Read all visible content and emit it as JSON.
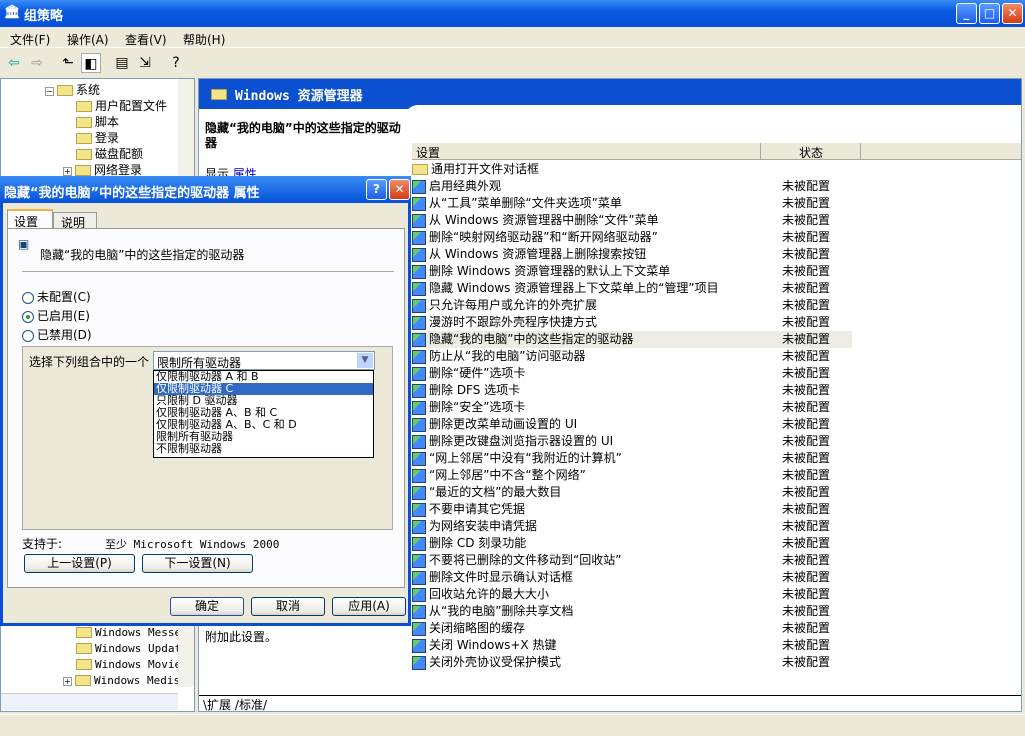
{
  "window": {
    "title": "组策略",
    "minimize": "_",
    "maximize": "□",
    "close": "✕"
  },
  "menu": [
    "文件(F)",
    "操作(A)",
    "查看(V)",
    "帮助(H)"
  ],
  "toolbar": [
    "back-icon",
    "forward-icon",
    "up-folder-icon",
    "show-hide-tree-icon",
    "properties-icon",
    "export-list-icon",
    "help-icon"
  ],
  "tree": {
    "items": [
      {
        "label": "系统",
        "indent": 0,
        "expander": "−"
      },
      {
        "label": "用户配置文件",
        "indent": 1
      },
      {
        "label": "脚本",
        "indent": 1
      },
      {
        "label": "登录",
        "indent": 1
      },
      {
        "label": "磁盘配额",
        "indent": 1
      },
      {
        "label": "网络登录",
        "indent": 1,
        "expander": "+"
      }
    ],
    "bottom_items": [
      {
        "label": "Windows Messe"
      },
      {
        "label": "Windows Updat"
      },
      {
        "label": "Windows Movie"
      },
      {
        "label": "Windows Medis",
        "expander": "+"
      }
    ]
  },
  "right": {
    "header": "Windows 资源管理器",
    "description_title": "隐藏“我的电脑”中的这些指定的驱动器",
    "description_link_prefix": "显示",
    "description_link": "属性",
    "description_tail": "附加此设置。",
    "columns": {
      "setting": "设置",
      "state": "状态"
    },
    "folder_row": "通用打开文件对话框",
    "rows": [
      {
        "name": "启用经典外观",
        "state": "未被配置"
      },
      {
        "name": "从“工具”菜单删除“文件夹选项”菜单",
        "state": "未被配置"
      },
      {
        "name": "从 Windows 资源管理器中删除“文件”菜单",
        "state": "未被配置"
      },
      {
        "name": "删除“映射网络驱动器”和“断开网络驱动器”",
        "state": "未被配置"
      },
      {
        "name": "从 Windows 资源管理器上删除搜索按钮",
        "state": "未被配置"
      },
      {
        "name": "删除 Windows 资源管理器的默认上下文菜单",
        "state": "未被配置"
      },
      {
        "name": "隐藏 Windows 资源管理器上下文菜单上的“管理”项目",
        "state": "未被配置"
      },
      {
        "name": "只允许每用户或允许的外壳扩展",
        "state": "未被配置"
      },
      {
        "name": "漫游时不跟踪外壳程序快捷方式",
        "state": "未被配置"
      },
      {
        "name": "隐藏“我的电脑”中的这些指定的驱动器",
        "state": "未被配置",
        "selected": true
      },
      {
        "name": "防止从“我的电脑”访问驱动器",
        "state": "未被配置"
      },
      {
        "name": "删除“硬件”选项卡",
        "state": "未被配置"
      },
      {
        "name": "删除 DFS 选项卡",
        "state": "未被配置"
      },
      {
        "name": "删除“安全”选项卡",
        "state": "未被配置"
      },
      {
        "name": "删除更改菜单动画设置的 UI",
        "state": "未被配置"
      },
      {
        "name": "删除更改键盘浏览指示器设置的 UI",
        "state": "未被配置"
      },
      {
        "name": "“网上邻居”中没有“我附近的计算机”",
        "state": "未被配置"
      },
      {
        "name": "“网上邻居”中不含“整个网络”",
        "state": "未被配置"
      },
      {
        "name": "“最近的文档”的最大数目",
        "state": "未被配置"
      },
      {
        "name": "不要申请其它凭据",
        "state": "未被配置"
      },
      {
        "name": "为网络安装申请凭据",
        "state": "未被配置"
      },
      {
        "name": "删除 CD 刻录功能",
        "state": "未被配置"
      },
      {
        "name": "不要将已删除的文件移动到“回收站”",
        "state": "未被配置"
      },
      {
        "name": "删除文件时显示确认对话框",
        "state": "未被配置"
      },
      {
        "name": "回收站允许的最大大小",
        "state": "未被配置"
      },
      {
        "name": "从“我的电脑”删除共享文档",
        "state": "未被配置"
      },
      {
        "name": "关闭缩略图的缓存",
        "state": "未被配置"
      },
      {
        "name": "关闭 Windows+X 热键",
        "state": "未被配置"
      },
      {
        "name": "关闭外壳协议受保护模式",
        "state": "未被配置"
      }
    ],
    "tabs": [
      "扩展",
      "标准"
    ]
  },
  "dialog": {
    "title": "隐藏“我的电脑”中的这些指定的驱动器 属性",
    "help": "?",
    "close": "✕",
    "tabs": [
      "设置",
      "说明"
    ],
    "policy_name": "隐藏“我的电脑”中的这些指定的驱动器",
    "options": [
      {
        "label": "未配置(C)",
        "checked": false
      },
      {
        "label": "已启用(E)",
        "checked": true
      },
      {
        "label": "已禁用(D)",
        "checked": false
      }
    ],
    "combo_label": "选择下列组合中的一个",
    "combo_value": "限制所有驱动器",
    "combo_options": [
      "仅限制驱动器 A 和 B",
      "仅限制驱动器 C",
      "只限制 D 驱动器",
      "仅限制驱动器 A、B 和 C",
      "仅限制驱动器 A、B、C 和 D",
      "限制所有驱动器",
      "不限制驱动器"
    ],
    "combo_highlighted": 1,
    "supported_label": "支持于:",
    "supported_value": "至少 Microsoft Windows 2000",
    "prev": "上一设置(P)",
    "next": "下一设置(N)",
    "ok": "确定",
    "cancel": "取消",
    "apply": "应用(A)"
  }
}
